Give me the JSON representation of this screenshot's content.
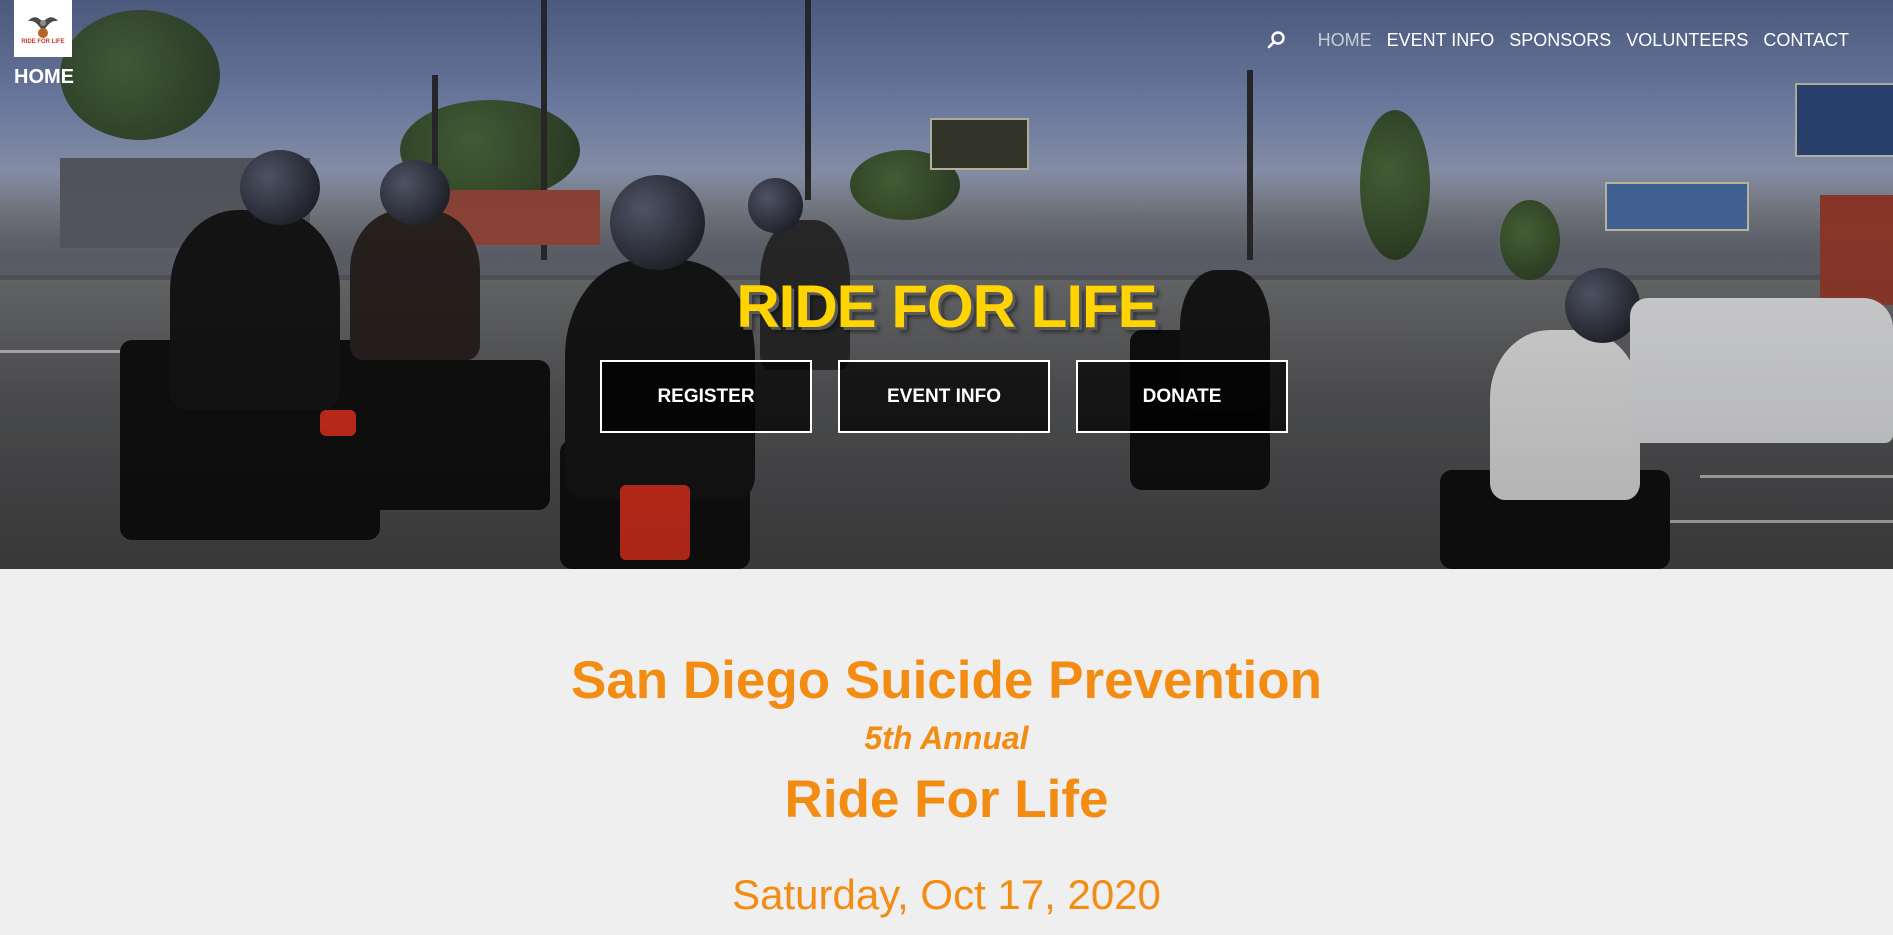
{
  "logo": {
    "text": "RIDE FOR LIFE",
    "caption": "HOME"
  },
  "nav": {
    "items": [
      "HOME",
      "EVENT INFO",
      "SPONSORS",
      "VOLUNTEERS",
      "CONTACT"
    ],
    "active": "HOME",
    "search_icon": "search-icon"
  },
  "hero": {
    "title": "RIDE FOR LIFE",
    "buttons": [
      "REGISTER",
      "EVENT INFO",
      "DONATE"
    ]
  },
  "content": {
    "org_title": "San Diego Suicide Prevention",
    "annual": "5th Annual",
    "event_name": "Ride For Life",
    "date": "Saturday, Oct 17, 2020"
  },
  "colors": {
    "accent_orange": "#f28c12",
    "hero_title_yellow": "#ffd400",
    "page_bg": "#efefef"
  }
}
